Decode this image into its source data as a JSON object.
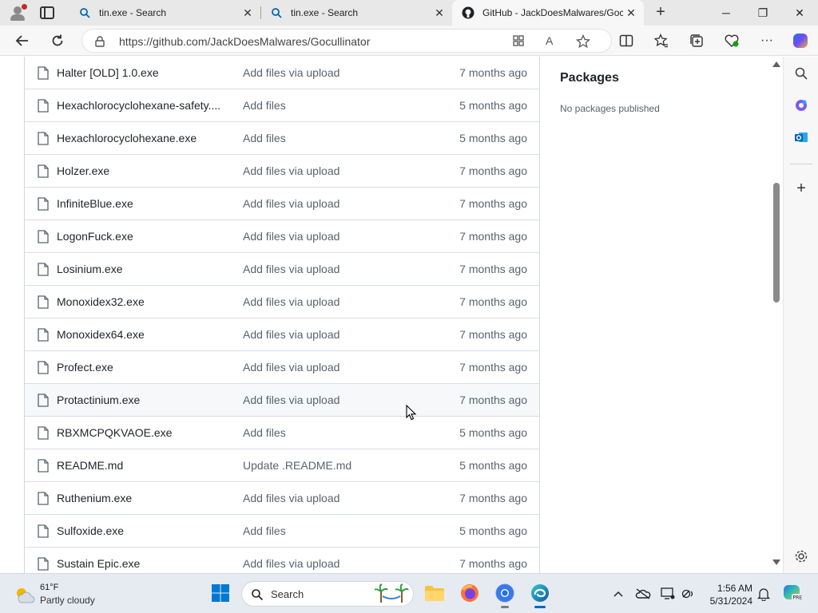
{
  "browser": {
    "tabs": [
      {
        "title": "tin.exe - Search",
        "icon": "search-icon"
      },
      {
        "title": "tin.exe - Search",
        "icon": "search-icon"
      },
      {
        "title": "GitHub - JackDoesMalwares/Gocullinator",
        "icon": "github-icon",
        "active": true
      }
    ],
    "url": "https://github.com/JackDoesMalwares/Gocullinator"
  },
  "files": [
    {
      "name": "Halter [OLD] 1.0.exe",
      "message": "Add files via upload",
      "age": "7 months ago"
    },
    {
      "name": "Hexachlorocyclohexane-safety....",
      "message": "Add files",
      "age": "5 months ago"
    },
    {
      "name": "Hexachlorocyclohexane.exe",
      "message": "Add files",
      "age": "5 months ago"
    },
    {
      "name": "Holzer.exe",
      "message": "Add files via upload",
      "age": "7 months ago"
    },
    {
      "name": "InfiniteBlue.exe",
      "message": "Add files via upload",
      "age": "7 months ago"
    },
    {
      "name": "LogonFuck.exe",
      "message": "Add files via upload",
      "age": "7 months ago"
    },
    {
      "name": "Losinium.exe",
      "message": "Add files via upload",
      "age": "7 months ago"
    },
    {
      "name": "Monoxidex32.exe",
      "message": "Add files via upload",
      "age": "7 months ago"
    },
    {
      "name": "Monoxidex64.exe",
      "message": "Add files via upload",
      "age": "7 months ago"
    },
    {
      "name": "Profect.exe",
      "message": "Add files via upload",
      "age": "7 months ago"
    },
    {
      "name": "Protactinium.exe",
      "message": "Add files via upload",
      "age": "7 months ago"
    },
    {
      "name": "RBXMCPQKVAOE.exe",
      "message": "Add files",
      "age": "5 months ago"
    },
    {
      "name": "README.md",
      "message": "Update .README.md",
      "age": "5 months ago"
    },
    {
      "name": "Ruthenium.exe",
      "message": "Add files via upload",
      "age": "7 months ago"
    },
    {
      "name": "Sulfoxide.exe",
      "message": "Add files",
      "age": "5 months ago"
    },
    {
      "name": "Sustain Epic.exe",
      "message": "Add files via upload",
      "age": "7 months ago"
    }
  ],
  "sidebar": {
    "packages_title": "Packages",
    "packages_empty": "No packages published"
  },
  "taskbar": {
    "weather_temp": "61°F",
    "weather_cond": "Partly cloudy",
    "search_label": "Search",
    "time": "1:56 AM",
    "date": "5/31/2024"
  },
  "colors": {
    "accent": "#0078d4",
    "border": "#d0d7de",
    "muted_text": "#59636e"
  }
}
